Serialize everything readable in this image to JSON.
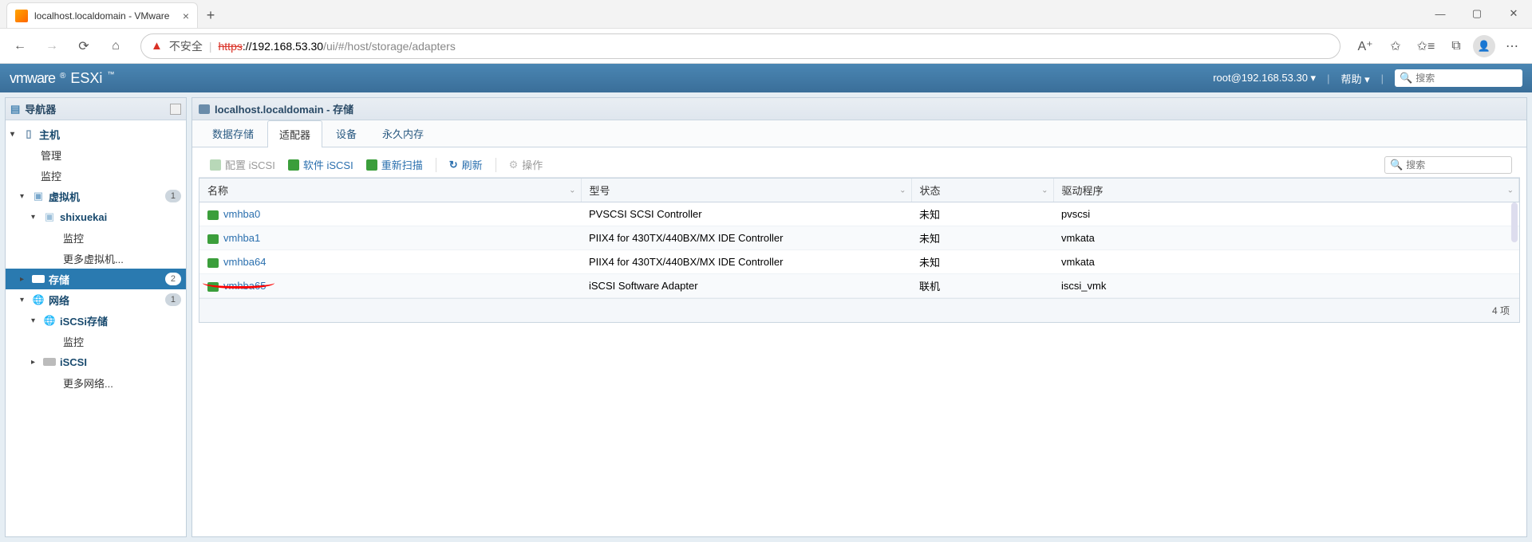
{
  "browser": {
    "tab_title": "localhost.localdomain - VMware",
    "unsafe_label": "不安全",
    "url_https": "https",
    "url_host": "://192.168.53.30",
    "url_path": "/ui/#/host/storage/adapters",
    "window": {
      "min": "—",
      "max": "▢",
      "close": "✕"
    }
  },
  "esxi": {
    "brand_vm": "vmware",
    "brand_esxi": "ESXi",
    "user": "root@192.168.53.30",
    "help": "帮助",
    "search_placeholder": "搜索"
  },
  "navigator": {
    "title": "导航器",
    "items": {
      "host": "主机",
      "manage": "管理",
      "monitor": "监控",
      "vms": "虚拟机",
      "vms_badge": "1",
      "vm1": "shixuekai",
      "vm_monitor": "监控",
      "more_vms": "更多虚拟机...",
      "storage": "存储",
      "storage_badge": "2",
      "network": "网络",
      "network_badge": "1",
      "iscsi_store": "iSCSi存储",
      "iscsi_monitor": "监控",
      "iscsi": "iSCSI",
      "more_nets": "更多网络..."
    }
  },
  "content": {
    "title": "localhost.localdomain - 存储",
    "tabs": [
      "数据存储",
      "适配器",
      "设备",
      "永久内存"
    ],
    "active_tab_index": 1,
    "toolbar": {
      "configure_iscsi": "配置 iSCSI",
      "software_iscsi": "软件 iSCSI",
      "rescan": "重新扫描",
      "refresh": "刷新",
      "actions": "操作",
      "search_placeholder": "搜索"
    },
    "table": {
      "columns": [
        "名称",
        "型号",
        "状态",
        "驱动程序"
      ],
      "rows": [
        {
          "name": "vmhba0",
          "model": "PVSCSI SCSI Controller",
          "status": "未知",
          "driver": "pvscsi"
        },
        {
          "name": "vmhba1",
          "model": "PIIX4 for 430TX/440BX/MX IDE Controller",
          "status": "未知",
          "driver": "vmkata"
        },
        {
          "name": "vmhba64",
          "model": "PIIX4 for 430TX/440BX/MX IDE Controller",
          "status": "未知",
          "driver": "vmkata"
        },
        {
          "name": "vmhba65",
          "model": "iSCSI Software Adapter",
          "status": "联机",
          "driver": "iscsi_vmk"
        }
      ],
      "footer": "4 项"
    }
  }
}
